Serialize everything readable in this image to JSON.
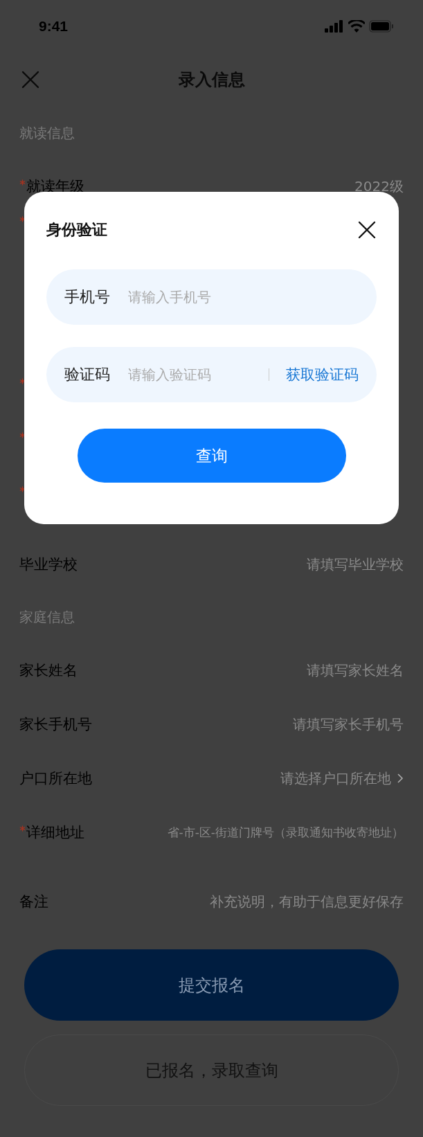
{
  "status_bar": {
    "time": "9:41"
  },
  "nav": {
    "title": "录入信息"
  },
  "form": [
    {
      "kind": "section",
      "title": "就读信息"
    },
    {
      "kind": "field",
      "label": "就读年级",
      "required": true,
      "value": "2022级"
    },
    {
      "kind": "obscured",
      "required": true
    },
    {
      "kind": "obscured"
    },
    {
      "kind": "obscured"
    },
    {
      "kind": "obscured",
      "required": true
    },
    {
      "kind": "obscured",
      "required": true
    },
    {
      "kind": "obscured",
      "required": true
    },
    {
      "kind": "field",
      "label": "毕业学校",
      "required": false,
      "placeholder": "请填写毕业学校"
    },
    {
      "kind": "section",
      "title": "家庭信息"
    },
    {
      "kind": "field",
      "label": "家长姓名",
      "required": false,
      "placeholder": "请填写家长姓名"
    },
    {
      "kind": "field",
      "label": "家长手机号",
      "required": false,
      "placeholder": "请填写家长手机号"
    },
    {
      "kind": "field",
      "label": "户口所在地",
      "required": false,
      "placeholder": "请选择户口所在地",
      "chevron": true
    },
    {
      "kind": "field",
      "label": "详细地址",
      "required": true,
      "placeholder": "省-市-区-街道门牌号（录取通知书收寄地址）",
      "small": true
    },
    {
      "kind": "field",
      "label": "备注",
      "required": false,
      "placeholder": "补充说明，有助于信息更好保存"
    }
  ],
  "buttons": [
    {
      "label": "提交报名",
      "kind": "primary"
    },
    {
      "label": "已报名，录取查询",
      "kind": "secondary"
    }
  ],
  "dialog": {
    "title": "身份验证",
    "fields": [
      {
        "label": "手机号",
        "placeholder": "请输入手机号"
      },
      {
        "label": "验证码",
        "placeholder": "请输入验证码",
        "action": "获取验证码"
      }
    ],
    "button": "查询"
  }
}
